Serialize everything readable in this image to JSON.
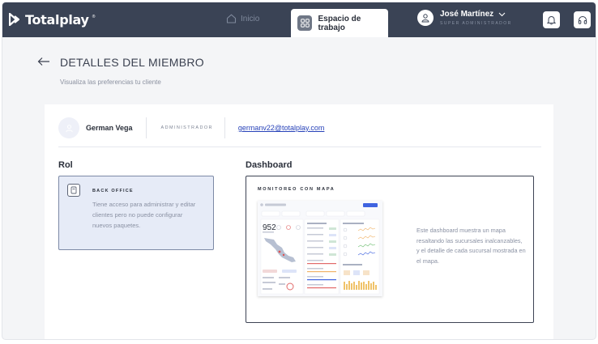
{
  "nav": {
    "brand": "Totalplay",
    "brand_mark": "®",
    "inicio": "Inicio",
    "workspace": "Espacio de trabajo",
    "user_name": "José Martínez",
    "user_role": "SUPER ADMINISTRADOR",
    "icons": [
      "home-icon",
      "workspace-grid-icon",
      "user-icon",
      "chevron-down-icon",
      "bell-icon",
      "headset-icon"
    ]
  },
  "header": {
    "title": "DETALLES DEL MIEMBRO",
    "subtitle": "Visualiza las preferencias tu cliente"
  },
  "member": {
    "name": "German Vega",
    "role": "ADMINISTRADOR",
    "email": "germanv22@totalplay.com"
  },
  "rol": {
    "section_title": "Rol",
    "card_title": "BACK OFFICE",
    "card_desc": "Tiene acceso para administrar y editar clientes pero no puede configurar nuevos paquetes."
  },
  "dashboard": {
    "section_title": "Dashboard",
    "card_title": "MONITOREO CON MAPA",
    "card_desc": "Este dashboard muestra un mapa resaltando las sucursales inalcanzables, y el detalle de cada sucursal mostrada en el mapa."
  },
  "colors": {
    "nav_bg": "#3a4355",
    "accent_blue": "#2742b9",
    "selected_card_bg": "#e6ebf7"
  }
}
